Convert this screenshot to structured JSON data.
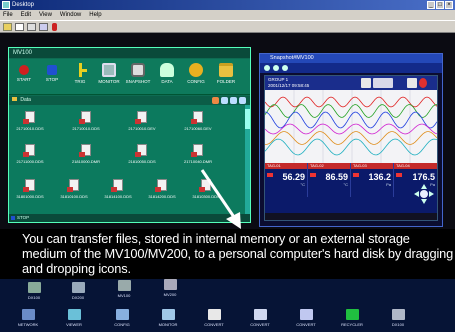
{
  "window": {
    "title": "Desktop",
    "controls": [
      "_",
      "□",
      "×"
    ]
  },
  "menu": [
    "File",
    "Edit",
    "View",
    "Window",
    "Help"
  ],
  "toolbar_icons": [
    "open-icon",
    "copy-icon",
    "paste-icon",
    "properties-icon",
    "help-icon"
  ],
  "mv_window": {
    "title": "MV100",
    "tools": [
      {
        "label": "START",
        "icon": "record-icon",
        "color": "#d02020"
      },
      {
        "label": "STOP",
        "icon": "stop-icon",
        "color": "#2050d0"
      },
      {
        "label": "TRIG",
        "icon": "trigger-icon",
        "color": "#e8d020"
      },
      {
        "label": "MONITOR",
        "icon": "monitor-icon",
        "color": "#9bb"
      },
      {
        "label": "SNAPSHOT",
        "icon": "camera-icon",
        "color": "#ddd"
      },
      {
        "label": "DATA",
        "icon": "data-icon",
        "color": "#cfd"
      },
      {
        "label": "CONFIG",
        "icon": "config-icon",
        "color": "#e8b020"
      },
      {
        "label": "FOLDER",
        "icon": "folder-icon",
        "color": "#e8c040"
      }
    ],
    "folder_label": "Data",
    "files": [
      "21710010.DDS",
      "21710010.DDS",
      "21710010.DEV",
      "21710060.DEV",
      "21711000.DDS",
      "21810000.DMR",
      "21810050.DDS",
      "21710040.DMR",
      "31801000.DDS",
      "31810100.DDS",
      "31814100.DDS",
      "31814200.DDS",
      "31810300.DDS"
    ],
    "status": "STOP"
  },
  "snapshot": {
    "title": "Snapshot#MV100",
    "group": "GROUP 1",
    "datetime": "2001/12/17 09:58:45",
    "readouts": [
      {
        "tag": "TAG-01",
        "value": "56.29",
        "unit": "°C"
      },
      {
        "tag": "TAG-02",
        "value": "86.59",
        "unit": "°C"
      },
      {
        "tag": "TAG-03",
        "value": "136.2",
        "unit": "Pa"
      },
      {
        "tag": "TAG-04",
        "value": "176.5",
        "unit": "Pa"
      }
    ],
    "trend_colors": [
      "#e02020",
      "#20a020",
      "#2040e0",
      "#d020d0",
      "#e09020",
      "#20b0c0"
    ]
  },
  "caption": "You can transfer files, stored in internal memory or an external storage medium of the MV100/MV200, to a personal computer's hard disk by dragging and dropping icons.",
  "desktop_icons_row1": [
    {
      "label": "DX100",
      "icon": "recorder-icon",
      "color": "#8a9"
    },
    {
      "label": "DX200",
      "icon": "recorder-icon",
      "color": "#9ab"
    },
    {
      "label": "MV100",
      "icon": "recorder-icon",
      "color": "#9aa"
    },
    {
      "label": "MV200",
      "icon": "recorder-icon",
      "color": "#aab"
    }
  ],
  "desktop_icons_row2": [
    {
      "label": "NETWORK",
      "icon": "network-icon",
      "color": "#6a8cc8"
    },
    {
      "label": "VIEWER",
      "icon": "viewer-icon",
      "color": "#6ac0d8"
    },
    {
      "label": "CONFIG",
      "icon": "config-icon",
      "color": "#88b0e0"
    },
    {
      "label": "MONITOR",
      "icon": "monitor-icon",
      "color": "#a0c8e8"
    },
    {
      "label": "CONVERT",
      "icon": "convert-icon",
      "color": "#e8e8e8"
    },
    {
      "label": "CONVERT",
      "icon": "convert-icon",
      "color": "#d0d8f0"
    },
    {
      "label": "CONVERT",
      "icon": "convert-icon",
      "color": "#c0c8f0"
    },
    {
      "label": "RECYCLER",
      "icon": "recycle-icon",
      "color": "#20c040"
    },
    {
      "label": "DX100",
      "icon": "recorder-icon",
      "color": "#b0b8c8"
    }
  ]
}
